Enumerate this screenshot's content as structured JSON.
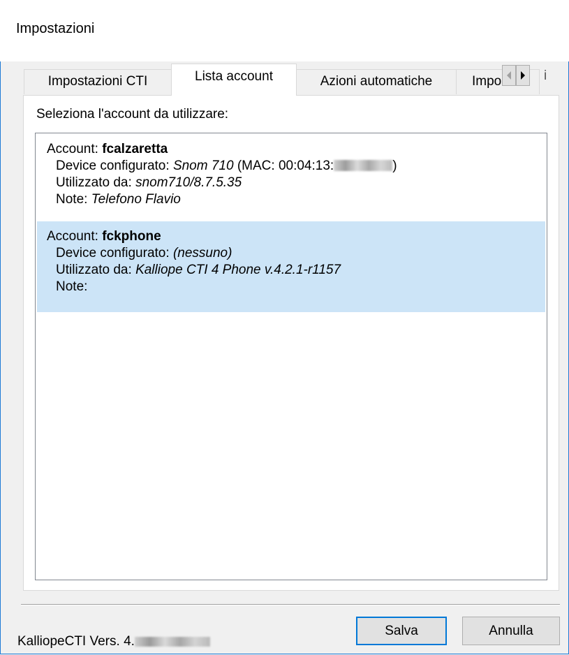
{
  "window": {
    "title": "Impostazioni"
  },
  "tabs": [
    {
      "label": "Impostazioni CTI"
    },
    {
      "label": "Lista account"
    },
    {
      "label": "Azioni automatiche"
    },
    {
      "label": "Impost"
    }
  ],
  "tab_overflow_glyph": "i",
  "panel": {
    "label": "Seleziona l'account da utilizzare:"
  },
  "accounts": [
    {
      "account_prefix": "Account:",
      "account_name": "fcalzaretta",
      "device_prefix": "Device configurato:",
      "device_value": "Snom 710",
      "mac_prefix": " (MAC: 00:04:13:",
      "mac_suffix": ")",
      "used_prefix": "Utilizzato da:",
      "used_value": "snom710/8.7.5.35",
      "note_prefix": "Note:",
      "note_value": "Telefono Flavio",
      "selected": false
    },
    {
      "account_prefix": "Account:",
      "account_name": "fckphone",
      "device_prefix": "Device configurato:",
      "device_value": "(nessuno)",
      "used_prefix": "Utilizzato da:",
      "used_value": "Kalliope CTI 4 Phone v.4.2.1-r1157",
      "note_prefix": "Note:",
      "note_value": "",
      "selected": true
    }
  ],
  "footer": {
    "version_prefix": "KalliopeCTI Vers. 4.",
    "save_label": "Salva",
    "cancel_label": "Annulla"
  },
  "colors": {
    "selection": "#cce4f7",
    "default_button_border": "#0078d7",
    "window_border": "#1e7bd6"
  }
}
